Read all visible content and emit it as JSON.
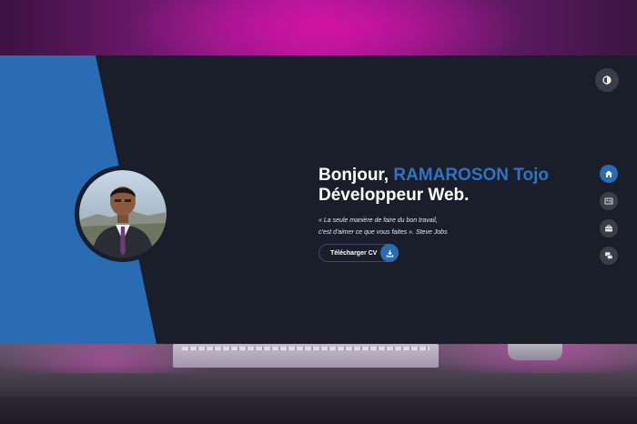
{
  "hero": {
    "greeting": "Bonjour,",
    "name": "RAMAROSON Tojo",
    "role": "Développeur Web.",
    "quote_line1": "« La seule manière de faire du bon travail,",
    "quote_line2": "c'est d'aimer ce que vous faites ». Steve Jobs",
    "cv_button_label": "Télécharger CV"
  },
  "icons": {
    "theme_toggle": "half-circle-icon",
    "cv": "download-icon",
    "nav": [
      "home-icon",
      "id-card-icon",
      "briefcase-icon",
      "chat-icon"
    ]
  },
  "colors": {
    "accent": "#2a6cb4",
    "background": "#1a1e2b",
    "nav_inactive": "#3b3e48"
  }
}
